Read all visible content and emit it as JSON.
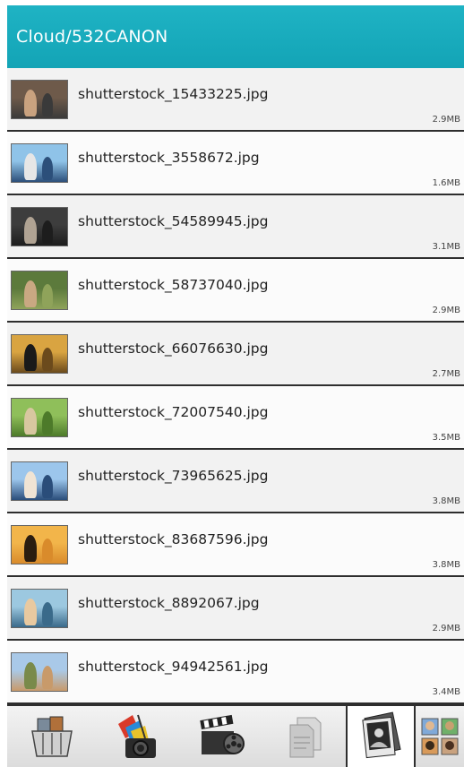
{
  "header": {
    "title": "Cloud/532CANON"
  },
  "files": [
    {
      "name": "shutterstock_15433225.jpg",
      "size": "2.9MB",
      "thumb": [
        "#6e5a4a",
        "#c9a27f",
        "#3a3a3a"
      ]
    },
    {
      "name": "shutterstock_3558672.jpg",
      "size": "1.6MB",
      "thumb": [
        "#8fc3e8",
        "#e6e6e6",
        "#2c4f7a"
      ]
    },
    {
      "name": "shutterstock_54589945.jpg",
      "size": "3.1MB",
      "thumb": [
        "#3d3d3d",
        "#b0a393",
        "#1d1d1d"
      ]
    },
    {
      "name": "shutterstock_58737040.jpg",
      "size": "2.9MB",
      "thumb": [
        "#5c7a3c",
        "#c9a882",
        "#8fa35a"
      ]
    },
    {
      "name": "shutterstock_66076630.jpg",
      "size": "2.7MB",
      "thumb": [
        "#d9a441",
        "#1a1a1a",
        "#6b4a1c"
      ]
    },
    {
      "name": "shutterstock_72007540.jpg",
      "size": "3.5MB",
      "thumb": [
        "#8fbf5a",
        "#d8c7a0",
        "#4d7a2a"
      ]
    },
    {
      "name": "shutterstock_73965625.jpg",
      "size": "3.8MB",
      "thumb": [
        "#9cc6ec",
        "#f0e4d4",
        "#2a4d7a"
      ]
    },
    {
      "name": "shutterstock_83687596.jpg",
      "size": "3.8MB",
      "thumb": [
        "#f2b54a",
        "#2b1d10",
        "#d98b2b"
      ]
    },
    {
      "name": "shutterstock_8892067.jpg",
      "size": "2.9MB",
      "thumb": [
        "#9cc8e0",
        "#e8c9a0",
        "#3a6a8a"
      ]
    },
    {
      "name": "shutterstock_94942561.jpg",
      "size": "3.4MB",
      "thumb": [
        "#a9c9e8",
        "#7a8a4a",
        "#c89a6a"
      ]
    }
  ],
  "bottom_tabs": [
    {
      "icon": "shopping-basket-icon",
      "selected": false
    },
    {
      "icon": "photo-camera-icon",
      "selected": false
    },
    {
      "icon": "video-clapper-icon",
      "selected": false
    },
    {
      "icon": "document-icon",
      "selected": false
    },
    {
      "icon": "photo-album-icon",
      "selected": true
    },
    {
      "icon": "contacts-grid-icon",
      "selected": false
    }
  ],
  "colors": {
    "header": "#13a4b6",
    "divider": "#2e2e2e"
  }
}
